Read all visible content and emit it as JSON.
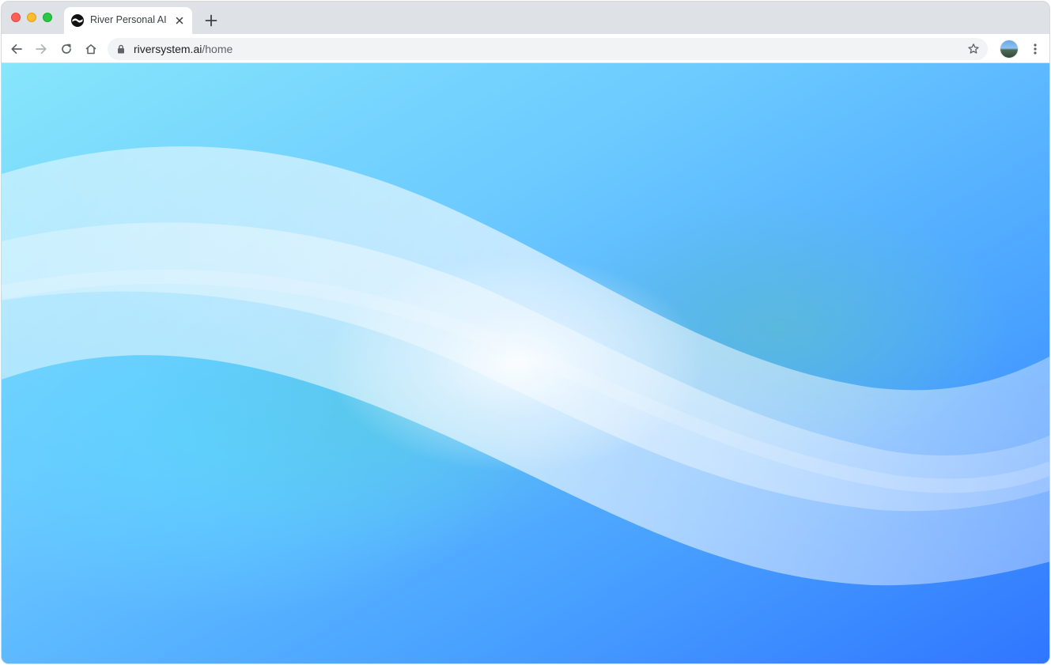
{
  "browser": {
    "tab": {
      "title": "River Personal AI",
      "favicon": "river-logo-icon"
    },
    "address_bar": {
      "domain": "riversystem.ai",
      "path": "/home"
    },
    "icons": {
      "back": "arrow-left-icon",
      "forward": "arrow-right-icon",
      "reload": "reload-icon",
      "home": "home-icon",
      "lock": "lock-icon",
      "bookmark": "star-icon",
      "menu": "kebab-menu-icon",
      "new_tab": "plus-icon",
      "close_tab": "close-icon"
    }
  },
  "page": {
    "background": {
      "style": "wave-gradient",
      "colors": {
        "top_left": "#86e6fb",
        "top_right": "#56a6ff",
        "bottom_right": "#2f76ff",
        "wave_highlight": "#e9f5fd"
      }
    }
  }
}
